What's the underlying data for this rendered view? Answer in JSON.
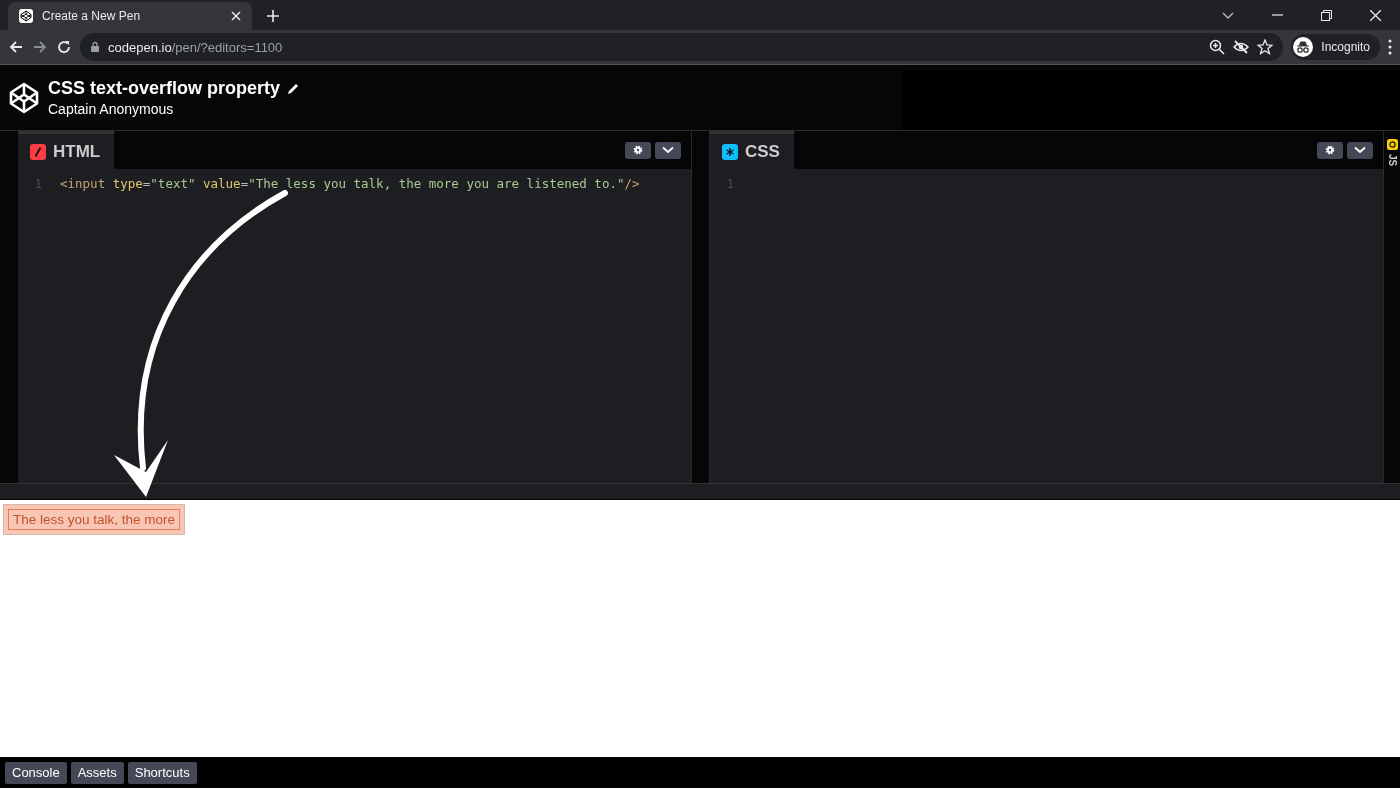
{
  "browser": {
    "tab_title": "Create a New Pen",
    "url_host": "codepen.io",
    "url_path": "/pen/?editors=1100",
    "profile": "Incognito"
  },
  "pen": {
    "title": "CSS text-overflow property",
    "author": "Captain Anonymous"
  },
  "editors": [
    {
      "kind": "html",
      "label": "HTML",
      "line_numbers": [
        "1"
      ],
      "lines": [
        [
          {
            "kind": "tag",
            "text": "<input"
          },
          {
            "kind": "attr",
            "text": " type"
          },
          {
            "kind": "punct",
            "text": "="
          },
          {
            "kind": "string",
            "text": "\"text\""
          },
          {
            "kind": "attr",
            "text": " value"
          },
          {
            "kind": "punct",
            "text": "="
          },
          {
            "kind": "string",
            "text": "\"The less you talk, the more you are listened to.\""
          },
          {
            "kind": "tag",
            "text": "/>"
          }
        ]
      ]
    },
    {
      "kind": "css",
      "label": "CSS",
      "line_numbers": [
        "1"
      ]
    }
  ],
  "collapsed_editor": {
    "label": "JS"
  },
  "preview": {
    "input_value": "The less you talk, the more"
  },
  "footer_buttons": [
    "Console",
    "Assets",
    "Shortcuts"
  ]
}
